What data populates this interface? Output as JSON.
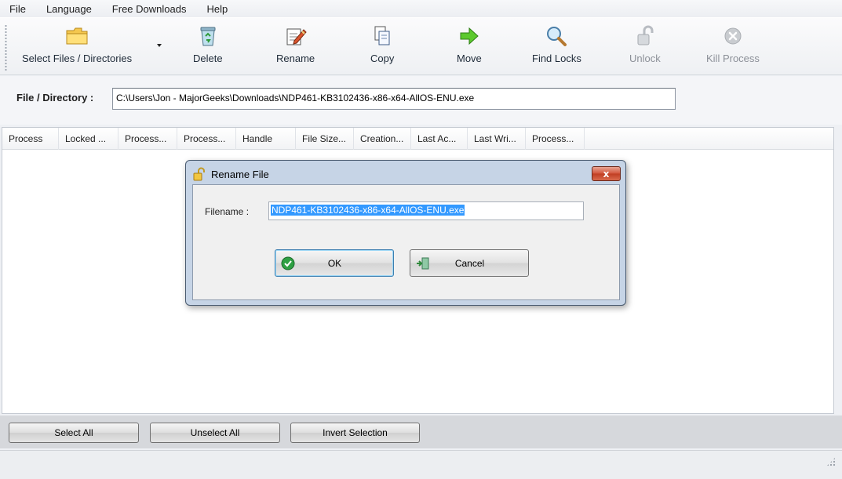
{
  "menu": [
    "File",
    "Language",
    "Free Downloads",
    "Help"
  ],
  "toolbar": {
    "select": "Select Files / Directories",
    "delete": "Delete",
    "rename": "Rename",
    "copy": "Copy",
    "move": "Move",
    "find_locks": "Find Locks",
    "unlock": "Unlock",
    "kill_process": "Kill Process"
  },
  "path": {
    "label": "File / Directory :",
    "value": "C:\\Users\\Jon - MajorGeeks\\Downloads\\NDP461-KB3102436-x86-x64-AllOS-ENU.exe"
  },
  "list": {
    "columns": [
      "Process",
      "Locked ...",
      "Process...",
      "Process...",
      "Handle",
      "File Size...",
      "Creation...",
      "Last Ac...",
      "Last Wri...",
      "Process..."
    ]
  },
  "bottom": {
    "select_all": "Select All",
    "unselect_all": "Unselect All",
    "invert_selection": "Invert Selection"
  },
  "dialog": {
    "title": "Rename File",
    "close": "x",
    "filename_label": "Filename :",
    "filename_value": "NDP461-KB3102436-x86-x64-AllOS-ENU.exe",
    "ok": "OK",
    "cancel": "Cancel"
  },
  "icons": {
    "folder": "folder-icon",
    "recycle": "recycle-bin-icon",
    "rename": "rename-pencil-icon",
    "copy": "copy-documents-icon",
    "move": "green-arrow-icon",
    "find": "magnifier-icon",
    "unlock": "padlock-open-icon",
    "kill": "kill-x-icon"
  },
  "colors": {
    "selection": "#3399ff",
    "ok_check": "#2ea043",
    "move_arrow": "#36b21c",
    "close_button": "#c94a30"
  }
}
